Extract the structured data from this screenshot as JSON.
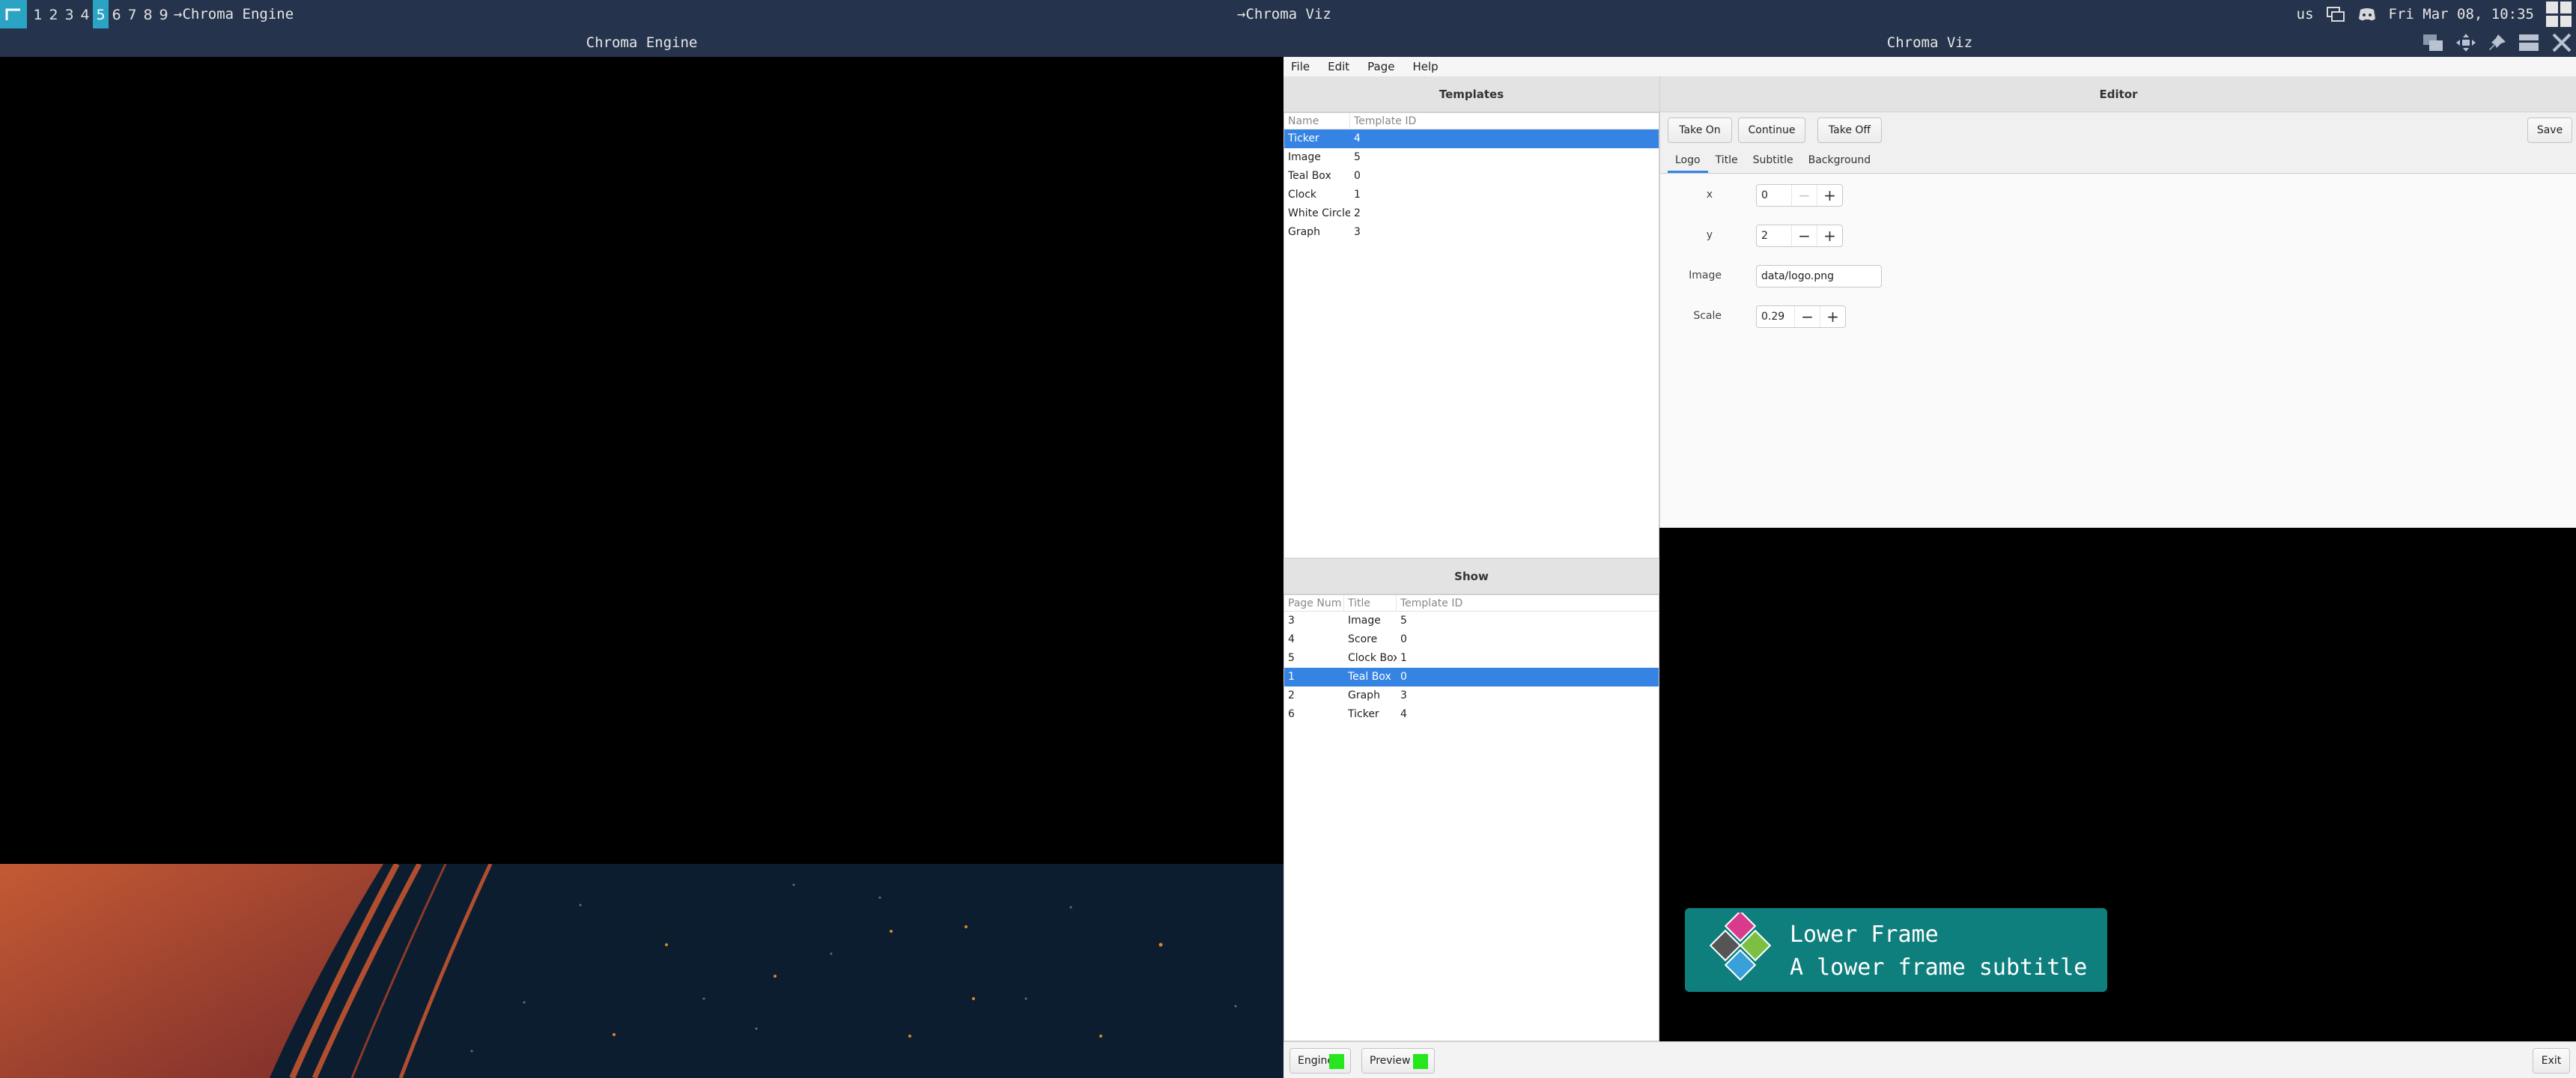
{
  "topbar": {
    "workspaces": [
      "1",
      "2",
      "3",
      "4",
      "5",
      "6",
      "7",
      "8",
      "9"
    ],
    "active_workspace": "5",
    "left_title": "→Chroma Engine",
    "center_title": "→Chroma Viz",
    "keyboard_layout": "us",
    "datetime": "Fri Mar 08, 10:35"
  },
  "windows": {
    "engine_title": "Chroma Engine",
    "viz_title": "Chroma Viz"
  },
  "menu": [
    "File",
    "Edit",
    "Page",
    "Help"
  ],
  "templates": {
    "header": "Templates",
    "columns": [
      "Name",
      "Template ID"
    ],
    "rows": [
      {
        "name": "Ticker",
        "id": "4",
        "selected": true
      },
      {
        "name": "Image",
        "id": "5"
      },
      {
        "name": "Teal Box",
        "id": "0"
      },
      {
        "name": "Clock",
        "id": "1"
      },
      {
        "name": "White Circle",
        "id": "2"
      },
      {
        "name": "Graph",
        "id": "3"
      }
    ]
  },
  "show": {
    "header": "Show",
    "columns": [
      "Page Num",
      "Title",
      "Template ID"
    ],
    "rows": [
      {
        "page": "3",
        "title": "Image",
        "id": "5"
      },
      {
        "page": "4",
        "title": "Score",
        "id": "0"
      },
      {
        "page": "5",
        "title": "Clock Box",
        "id": "1"
      },
      {
        "page": "1",
        "title": "Teal Box",
        "id": "0",
        "selected": true
      },
      {
        "page": "2",
        "title": "Graph",
        "id": "3"
      },
      {
        "page": "6",
        "title": "Ticker",
        "id": "4"
      }
    ]
  },
  "editor": {
    "header": "Editor",
    "buttons": {
      "take_on": "Take On",
      "continue": "Continue",
      "take_off": "Take Off",
      "save": "Save"
    },
    "tabs": [
      "Logo",
      "Title",
      "Subtitle",
      "Background"
    ],
    "active_tab": "Logo",
    "props": {
      "x_label": "x",
      "x_value": "0",
      "y_label": "y",
      "y_value": "2",
      "image_label": "Image",
      "image_value": "data/logo.png",
      "scale_label": "Scale",
      "scale_value": "0.29"
    }
  },
  "preview": {
    "title": "Lower Frame",
    "subtitle": "A lower frame subtitle",
    "logo_colors": [
      "#d93a8c",
      "#7bc043",
      "#3aa0d9",
      "#555555"
    ],
    "frame_color": "#0e7f7c"
  },
  "bottombar": {
    "engine": "Engine",
    "preview": "Preview",
    "exit": "Exit",
    "status_color": "#26e61e"
  }
}
